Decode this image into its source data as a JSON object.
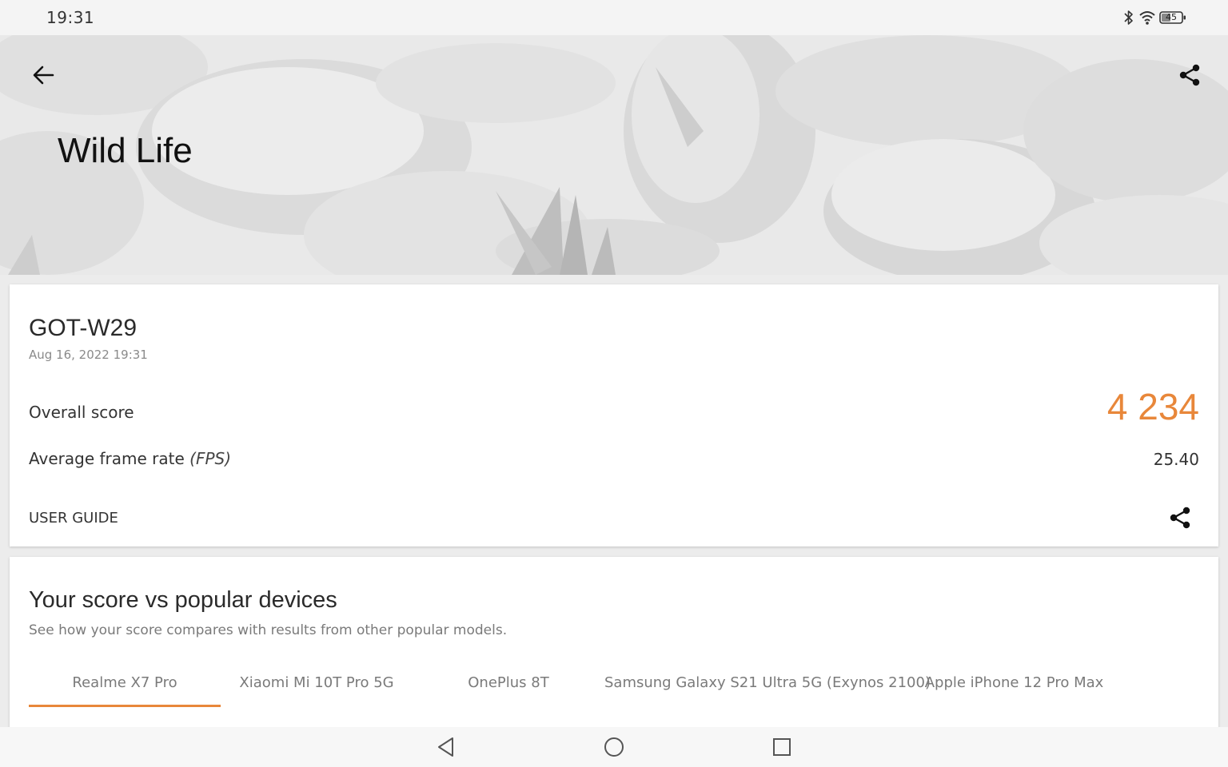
{
  "status_bar": {
    "time": "19:31",
    "battery_level": "45",
    "icons": [
      "bluetooth-icon",
      "wifi-icon",
      "battery-icon"
    ]
  },
  "header": {
    "title": "Wild Life",
    "back_icon": "arrow-left-icon",
    "share_icon": "share-icon"
  },
  "result": {
    "device_name": "GOT-W29",
    "date": "Aug 16, 2022 19:31",
    "overall_label": "Overall score",
    "overall_value": "4 234",
    "fps_label": "Average frame rate",
    "fps_unit": "(FPS)",
    "fps_value": "25.40",
    "user_guide_label": "USER GUIDE",
    "share_icon": "share-icon"
  },
  "compare": {
    "title": "Your score vs popular devices",
    "subtitle": "See how your score compares with results from other popular models.",
    "tabs": [
      {
        "label": "Realme X7 Pro",
        "active": true
      },
      {
        "label": "Xiaomi Mi 10T Pro 5G",
        "active": false
      },
      {
        "label": "OnePlus 8T",
        "active": false
      },
      {
        "label": "Samsung Galaxy S21 Ultra 5G (Exynos 2100)",
        "active": false
      },
      {
        "label": "Apple iPhone 12 Pro Max",
        "active": false
      }
    ]
  },
  "nav_bar": {
    "icons": [
      "back-triangle-icon",
      "home-circle-icon",
      "recents-square-icon"
    ]
  },
  "colors": {
    "accent": "#e8873a",
    "card_background": "#ffffff",
    "page_background": "#ececec"
  }
}
